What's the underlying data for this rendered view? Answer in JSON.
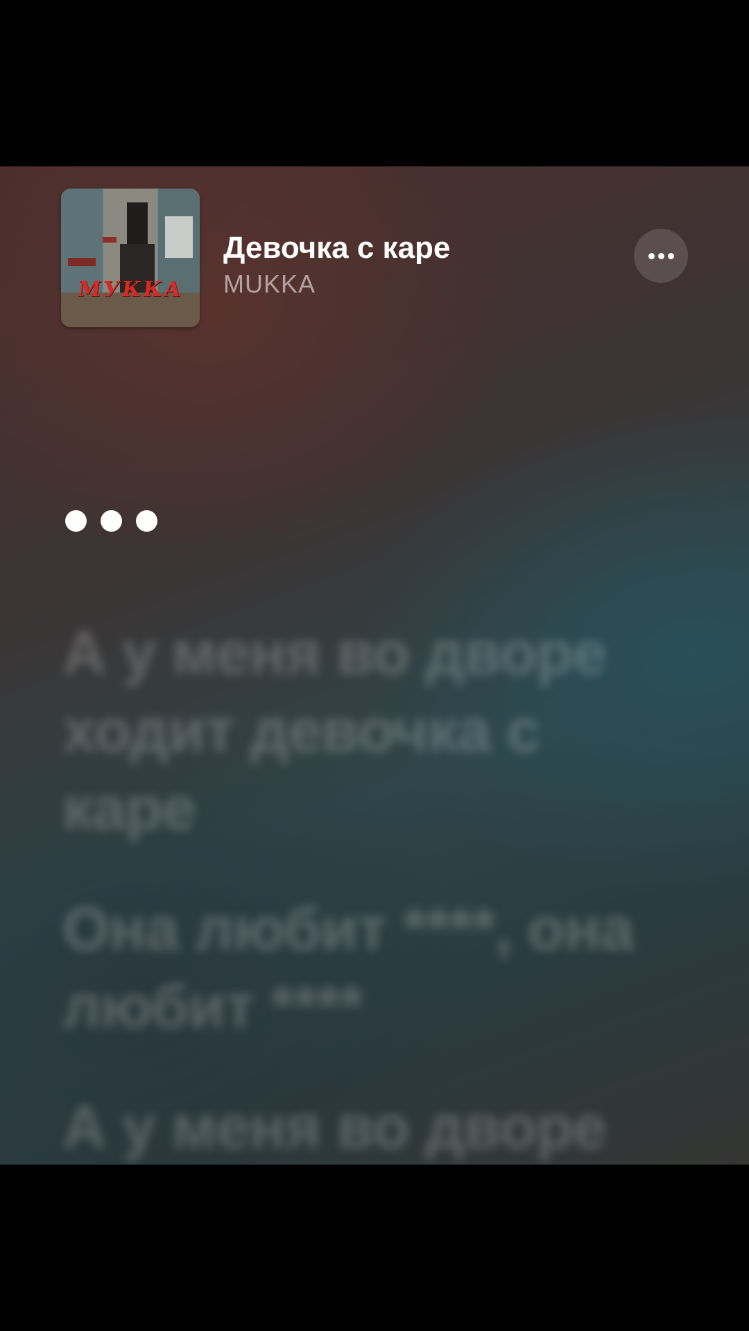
{
  "now_playing": {
    "song_title": "Девочка с каре",
    "artist": "MUKKA",
    "cover_text": "MУККА"
  },
  "lyrics": [
    "А у меня во дворе ходит девочка с каре",
    "Она любит ****, она любит ****",
    "А у меня во дворе"
  ],
  "icons": {
    "more": "ellipsis-icon",
    "instrumental_wait": "three-dots-icon"
  },
  "colors": {
    "title": "#ffffff",
    "artist": "#9a9292",
    "cover_accent": "#d62a23"
  }
}
